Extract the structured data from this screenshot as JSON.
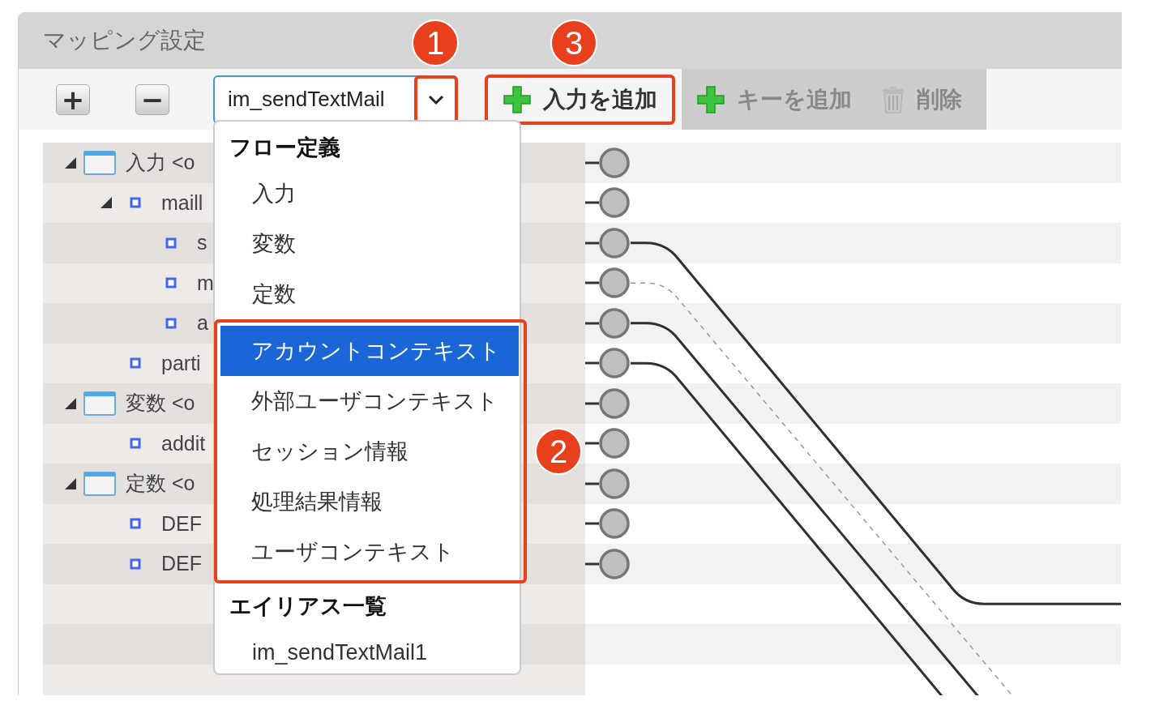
{
  "panel": {
    "title": "マッピング設定"
  },
  "toolbar": {
    "expand_all": {
      "label": "+"
    },
    "collapse_all": {
      "label": "−"
    },
    "source_select": {
      "value": "im_sendTextMail"
    },
    "buttons": [
      {
        "label": "入力を追加",
        "kind": "add",
        "disabled": false,
        "highlighted": true
      },
      {
        "label": "キーを追加",
        "kind": "add",
        "disabled": true,
        "highlighted": false
      },
      {
        "label": "削除",
        "kind": "delete",
        "disabled": true,
        "highlighted": false
      }
    ]
  },
  "tree": [
    {
      "kind": "folder",
      "label": "入力 <o",
      "expanded": true,
      "children": [
        {
          "kind": "field",
          "label": "maill",
          "expanded": true,
          "children": [
            {
              "kind": "field",
              "label": "s"
            },
            {
              "kind": "field",
              "label": "m"
            },
            {
              "kind": "field",
              "label": "a"
            }
          ]
        },
        {
          "kind": "field",
          "label": "parti"
        }
      ]
    },
    {
      "kind": "folder",
      "label": "変数 <o",
      "expanded": true,
      "children": [
        {
          "kind": "field",
          "label": "addit"
        }
      ]
    },
    {
      "kind": "folder",
      "label": "定数 <o",
      "expanded": true,
      "children": [
        {
          "kind": "field",
          "label": "DEF"
        },
        {
          "kind": "field",
          "label": "DEF"
        }
      ]
    }
  ],
  "dropdown": {
    "groups": [
      {
        "header": "フロー定義",
        "items": [
          {
            "label": "入力",
            "selected": false,
            "highlighted": false
          },
          {
            "label": "変数",
            "selected": false,
            "highlighted": false
          },
          {
            "label": "定数",
            "selected": false,
            "highlighted": false
          },
          {
            "label": "アカウントコンテキスト",
            "selected": true,
            "highlighted": true
          },
          {
            "label": "外部ユーザコンテキスト",
            "selected": false,
            "highlighted": true
          },
          {
            "label": "セッション情報",
            "selected": false,
            "highlighted": true
          },
          {
            "label": "処理結果情報",
            "selected": false,
            "highlighted": true
          },
          {
            "label": "ユーザコンテキスト",
            "selected": false,
            "highlighted": true
          }
        ]
      },
      {
        "header": "エイリアス一覧",
        "items": [
          {
            "label": "im_sendTextMail1",
            "selected": false,
            "highlighted": false
          }
        ]
      }
    ]
  },
  "callouts": [
    {
      "number": "1"
    },
    {
      "number": "3"
    },
    {
      "number": "2"
    }
  ]
}
